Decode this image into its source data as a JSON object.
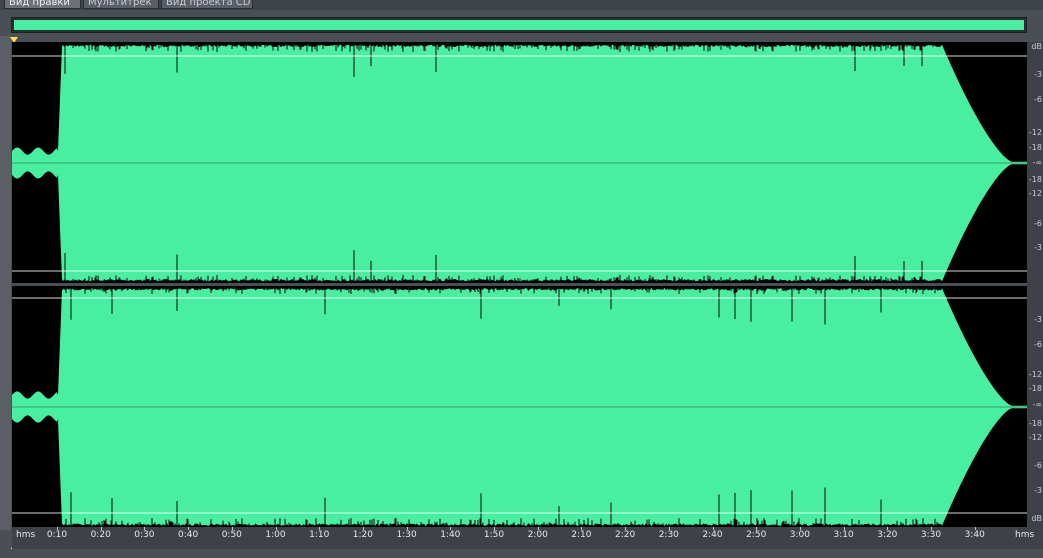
{
  "tabs": [
    {
      "label": "Вид правки",
      "active": true
    },
    {
      "label": "Мультитрек",
      "active": false
    },
    {
      "label": "Вид проекта CD",
      "active": false
    }
  ],
  "colors": {
    "waveform": "#49efa0",
    "background": "#000000",
    "centerline": "#3c9c6f",
    "dbline": "#ffffff",
    "marker": "#ffe14a"
  },
  "scale_top": [
    "dB",
    "-3",
    "-6",
    "-12",
    "-18",
    "-∞",
    "-18",
    "-12",
    "-6",
    "-3"
  ],
  "scale_bottom": [
    "-3",
    "-6",
    "-12",
    "-18",
    "-∞",
    "-18",
    "-12",
    "-6",
    "-3",
    "dB"
  ],
  "timeline": {
    "units_left": "hms",
    "units_right": "hms",
    "labels": [
      "0:10",
      "0:20",
      "0:30",
      "0:40",
      "0:50",
      "1:00",
      "1:10",
      "1:20",
      "1:30",
      "1:40",
      "1:50",
      "2:00",
      "2:10",
      "2:20",
      "2:30",
      "2:40",
      "2:50",
      "3:00",
      "3:10",
      "3:20",
      "3:30",
      "3:40"
    ]
  }
}
